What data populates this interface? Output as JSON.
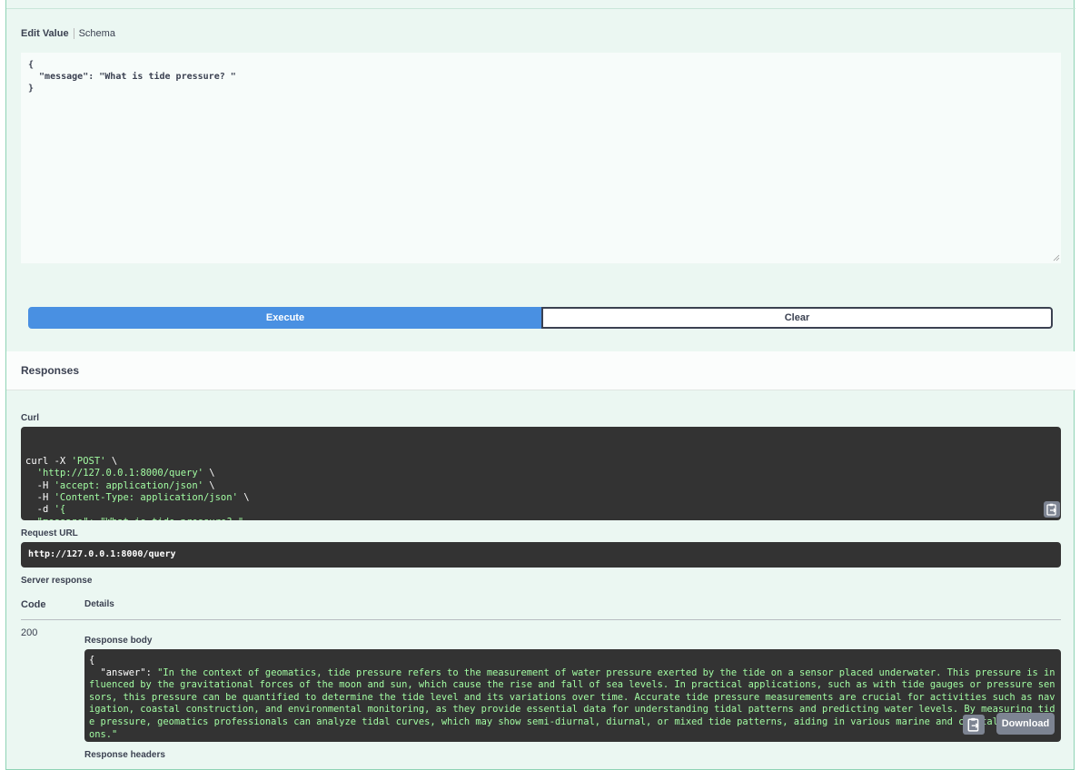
{
  "tabs": {
    "edit_value": "Edit Value",
    "schema": "Schema"
  },
  "editor": {
    "value": "{\n  \"message\": \"What is tide pressure? \"\n}"
  },
  "actions": {
    "execute": "Execute",
    "clear": "Clear"
  },
  "responses": {
    "title": "Responses"
  },
  "curl": {
    "label": "Curl",
    "lines": [
      {
        "plain": "curl -X ",
        "str": "'POST'",
        "after": " \\"
      },
      {
        "plain": "  ",
        "str": "'http://127.0.0.1:8000/query'",
        "after": " \\"
      },
      {
        "plain": "  -H ",
        "str": "'accept: application/json'",
        "after": " \\"
      },
      {
        "plain": "  -H ",
        "str": "'Content-Type: application/json'",
        "after": " \\"
      },
      {
        "plain": "  -d ",
        "str": "'{",
        "after": ""
      },
      {
        "plain": "",
        "str": "  \"message\": \"What is tide pressure? \"",
        "after": ""
      },
      {
        "plain": "",
        "str": "}'",
        "after": ""
      }
    ]
  },
  "request_url": {
    "label": "Request URL",
    "value": "http://127.0.0.1:8000/query"
  },
  "server_response": {
    "label": "Server response",
    "col_code": "Code",
    "col_details": "Details",
    "code": "200",
    "body_label": "Response body",
    "body_open": "{",
    "body_key": "  \"answer\"",
    "body_value": "\"In the context of geomatics, tide pressure refers to the measurement of water pressure exerted by the tide on a sensor placed underwater. This pressure is influenced by the gravitational forces of the moon and sun, which cause the rise and fall of sea levels. In practical applications, such as with tide gauges or pressure sensors, this pressure can be quantified to determine the tide level and its variations over time. Accurate tide pressure measurements are crucial for activities such as navigation, coastal construction, and environmental monitoring, as they provide essential data for understanding tidal patterns and predicting water levels. By measuring tide pressure, geomatics professionals can analyze tidal curves, which may show semi-diurnal, diurnal, or mixed tide patterns, aiding in various marine and coastal applications.\"",
    "body_close": "}",
    "download": "Download",
    "headers_label": "Response headers"
  },
  "icons": {
    "copy": "clipboard-icon",
    "resize": "resize-handle-icon"
  },
  "colors": {
    "execute": "#4990e2",
    "string_green": "#a2fca2",
    "code_bg": "#333333",
    "panel_bg": "#ebf7f2"
  }
}
